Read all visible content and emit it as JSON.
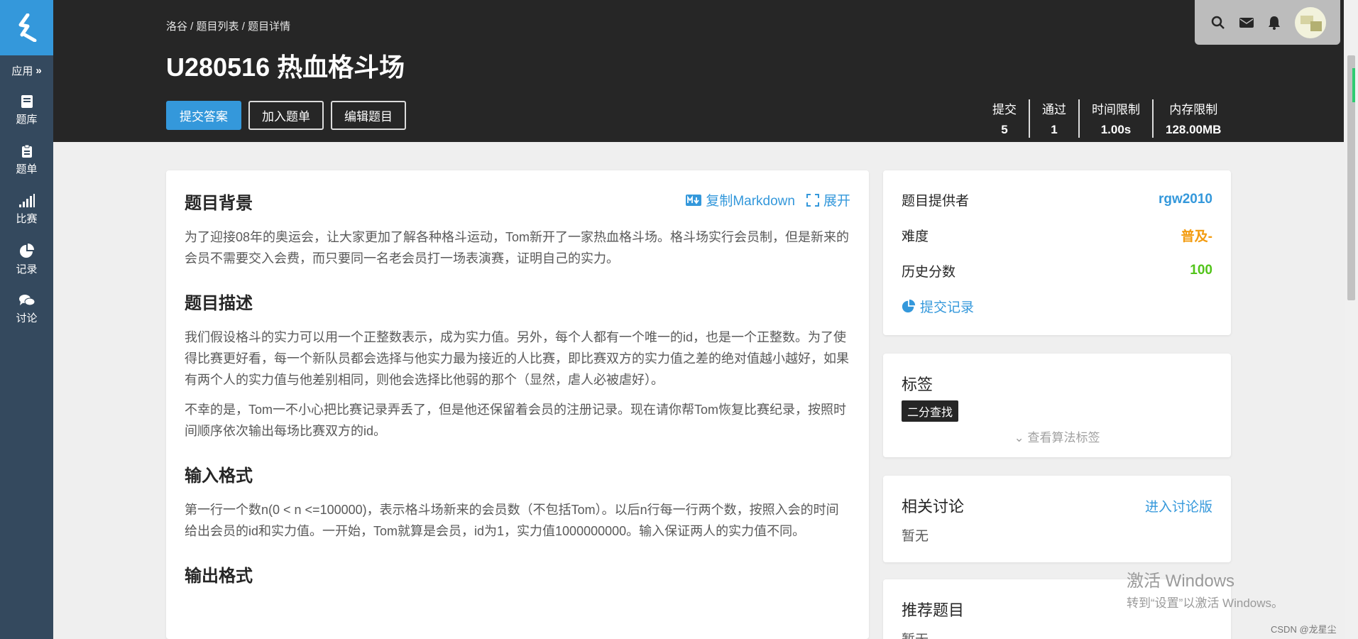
{
  "sidebar": {
    "apps_label": "应用",
    "items": [
      {
        "label": "题库",
        "icon": "book-icon"
      },
      {
        "label": "题单",
        "icon": "clipboard-icon"
      },
      {
        "label": "比赛",
        "icon": "signal-bars-icon"
      },
      {
        "label": "记录",
        "icon": "pie-chart-icon"
      },
      {
        "label": "讨论",
        "icon": "comments-icon"
      }
    ]
  },
  "header": {
    "breadcrumb": [
      "洛谷",
      "题目列表",
      "题目详情"
    ],
    "breadcrumb_sep": " / ",
    "title": "U280516 热血格斗场",
    "buttons": {
      "submit": "提交答案",
      "add_list": "加入题单",
      "edit": "编辑题目"
    },
    "stats": [
      {
        "label": "提交",
        "value": "5"
      },
      {
        "label": "通过",
        "value": "1"
      },
      {
        "label": "时间限制",
        "value": "1.00s"
      },
      {
        "label": "内存限制",
        "value": "128.00MB"
      }
    ]
  },
  "problem": {
    "copy_markdown": "复制Markdown",
    "expand": "展开",
    "sections": [
      {
        "title": "题目背景",
        "paragraphs": [
          "为了迎接08年的奥运会，让大家更加了解各种格斗运动，Tom新开了一家热血格斗场。格斗场实行会员制，但是新来的会员不需要交入会费，而只要同一名老会员打一场表演赛，证明自己的实力。"
        ]
      },
      {
        "title": "题目描述",
        "paragraphs": [
          "我们假设格斗的实力可以用一个正整数表示，成为实力值。另外，每个人都有一个唯一的id，也是一个正整数。为了使得比赛更好看，每一个新队员都会选择与他实力最为接近的人比赛，即比赛双方的实力值之差的绝对值越小越好，如果有两个人的实力值与他差别相同，则他会选择比他弱的那个（显然，虐人必被虐好）。",
          "不幸的是，Tom一不小心把比赛记录弄丢了，但是他还保留着会员的注册记录。现在请你帮Tom恢复比赛纪录，按照时间顺序依次输出每场比赛双方的id。"
        ]
      },
      {
        "title": "输入格式",
        "paragraphs": [
          "第一行一个数n(0 < n <=100000)，表示格斗场新来的会员数（不包括Tom）。以后n行每一行两个数，按照入会的时间给出会员的id和实力值。一开始，Tom就算是会员，id为1，实力值1000000000。输入保证两人的实力值不同。"
        ]
      },
      {
        "title": "输出格式",
        "paragraphs": []
      }
    ]
  },
  "info_card": {
    "provider_label": "题目提供者",
    "provider": "rgw2010",
    "difficulty_label": "难度",
    "difficulty": "普及-",
    "score_label": "历史分数",
    "score": "100",
    "submissions_link": "提交记录",
    "colors": {
      "difficulty": "#f39c11",
      "score": "#52c41a",
      "link": "#3498db"
    }
  },
  "tags_card": {
    "title": "标签",
    "tags": [
      "二分查找"
    ],
    "view_tags": "查看算法标签"
  },
  "discuss_card": {
    "title": "相关讨论",
    "link": "进入讨论版",
    "empty": "暂无"
  },
  "recommend_card": {
    "title": "推荐题目",
    "empty": "暂无"
  },
  "watermark": {
    "line1": "激活 Windows",
    "line2": "转到“设置”以激活 Windows。"
  },
  "footer_credit": "CSDN @龙星尘"
}
